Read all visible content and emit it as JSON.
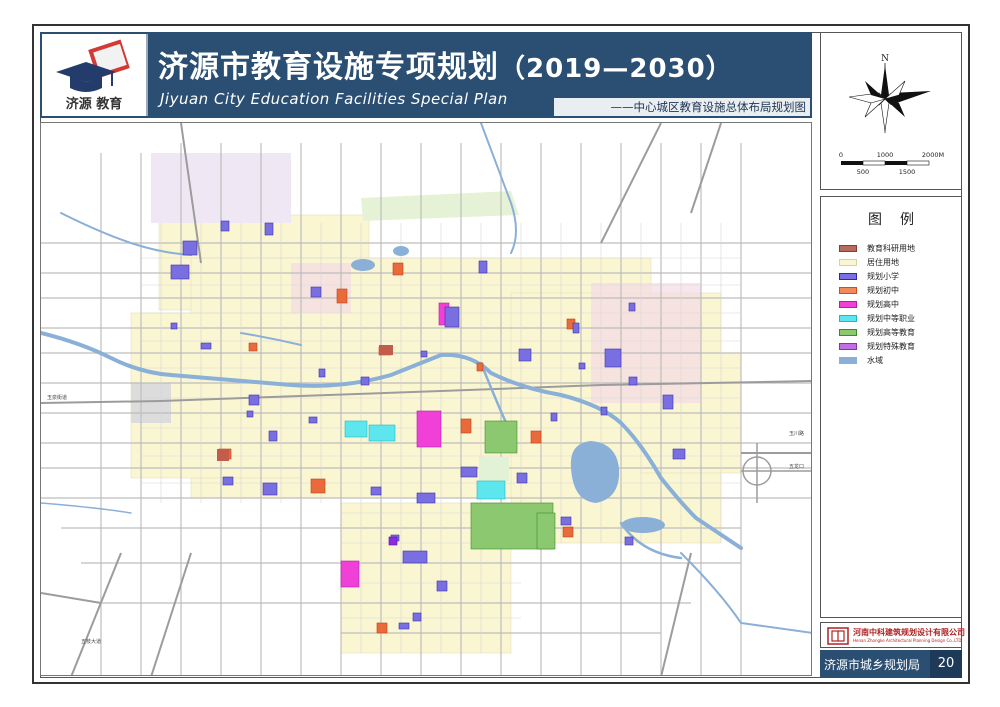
{
  "header": {
    "logo_text": "济源 教育",
    "title_cn": "济源市教育设施专项规划",
    "title_years": "（2019—2030）",
    "title_en": "Jiyuan City Education Facilities Special Plan",
    "subtitle": "——中心城区教育设施总体布局规划图"
  },
  "compass": {
    "north": "N",
    "scale_top": [
      "0",
      "1000",
      "2000M"
    ],
    "scale_bottom": [
      "500",
      "1500"
    ]
  },
  "legend": {
    "title": "图例",
    "items": [
      {
        "label": "教育科研用地",
        "fill": "#b76b5e",
        "stroke": "#8a3e33"
      },
      {
        "label": "居住用地",
        "fill": "#fbf6d2",
        "stroke": "#d8d2a0"
      },
      {
        "label": "规划小学",
        "fill": "#7a6fe0",
        "stroke": "#2a2ab0"
      },
      {
        "label": "规划初中",
        "fill": "#f08a5a",
        "stroke": "#d64b1d"
      },
      {
        "label": "规划高中",
        "fill": "#f040d8",
        "stroke": "#b020a8"
      },
      {
        "label": "规划中等职业",
        "fill": "#5ee6ee",
        "stroke": "#20b8c4"
      },
      {
        "label": "规划高等教育",
        "fill": "#8bc870",
        "stroke": "#3c8a2c"
      },
      {
        "label": "规划特殊教育",
        "fill": "#c070e0",
        "stroke": "#8830b0"
      },
      {
        "label": "水域",
        "fill": "#8ab0d8",
        "stroke": "#8ab0d8"
      }
    ]
  },
  "footer": {
    "company_cn": "河南中科建筑规划设计有限公司",
    "company_en": "Henan Zhongke Architectural Planning Design Co.,LTD",
    "bureau": "济源市城乡规划局",
    "page": "20"
  },
  "colors": {
    "header_bg": "#2a4f73",
    "primary_school": "#7a6fe0",
    "middle_school": "#f08a5a",
    "high_school": "#f040d8",
    "vocational": "#5ee6ee",
    "higher_edu": "#8bc870",
    "water": "#8ab0d8",
    "residential": "#fbf6d2"
  },
  "map": {
    "place_labels": [
      "玉泉街道",
      "玉川路",
      "五龙口",
      "五枝大道"
    ]
  }
}
